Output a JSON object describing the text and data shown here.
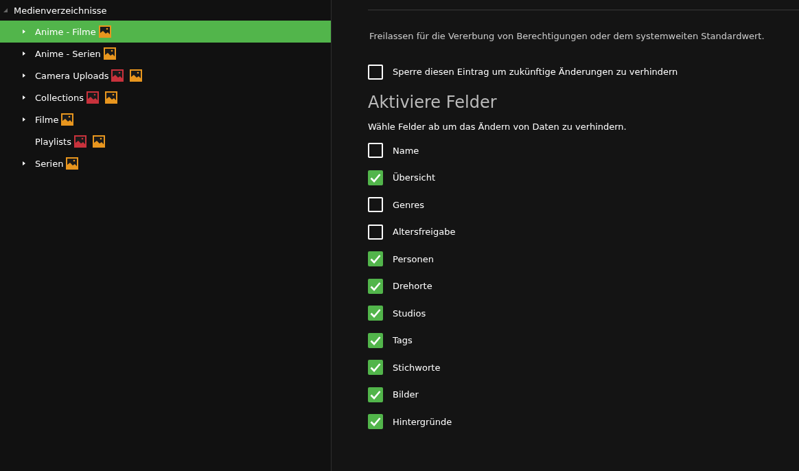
{
  "tree": {
    "label": "Medienverzeichnisse",
    "expanded": true,
    "children": [
      {
        "label": "Anime - Filme",
        "selected": true,
        "expandable": true,
        "badges": [
          {
            "color": "#e8961e"
          }
        ]
      },
      {
        "label": "Anime - Serien",
        "selected": false,
        "expandable": true,
        "badges": [
          {
            "color": "#e8961e"
          }
        ]
      },
      {
        "label": "Camera Uploads",
        "selected": false,
        "expandable": true,
        "badges": [
          {
            "color": "#c8323c"
          },
          {
            "color": "#e8961e"
          }
        ]
      },
      {
        "label": "Collections",
        "selected": false,
        "expandable": true,
        "badges": [
          {
            "color": "#c8323c"
          },
          {
            "color": "#e8961e"
          }
        ]
      },
      {
        "label": "Filme",
        "selected": false,
        "expandable": true,
        "badges": [
          {
            "color": "#e8961e"
          }
        ]
      },
      {
        "label": "Playlists",
        "selected": false,
        "expandable": false,
        "badges": [
          {
            "color": "#c8323c"
          },
          {
            "color": "#e8961e"
          }
        ]
      },
      {
        "label": "Serien",
        "selected": false,
        "expandable": true,
        "badges": [
          {
            "color": "#e8961e"
          }
        ]
      }
    ]
  },
  "settings": {
    "hint": "Freilassen für die Vererbung von Berechtigungen oder dem systemweiten Standardwert.",
    "lock": {
      "label": "Sperre diesen Eintrag um zukünftige Änderungen zu verhindern",
      "checked": false
    },
    "heading": "Aktiviere Felder",
    "description": "Wähle Felder ab um das Ändern von Daten zu verhindern.",
    "fields": [
      {
        "label": "Name",
        "checked": false
      },
      {
        "label": "Übersicht",
        "checked": true
      },
      {
        "label": "Genres",
        "checked": false
      },
      {
        "label": "Altersfreigabe",
        "checked": false
      },
      {
        "label": "Personen",
        "checked": true
      },
      {
        "label": "Drehorte",
        "checked": true
      },
      {
        "label": "Studios",
        "checked": true
      },
      {
        "label": "Tags",
        "checked": true
      },
      {
        "label": "Stichworte",
        "checked": true
      },
      {
        "label": "Bilder",
        "checked": true
      },
      {
        "label": "Hintergründe",
        "checked": true
      }
    ]
  }
}
